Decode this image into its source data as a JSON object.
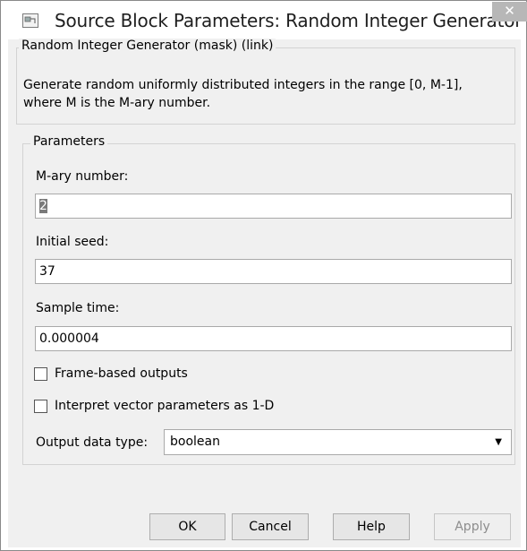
{
  "window": {
    "title": "Source Block Parameters: Random Integer Generator",
    "close_glyph": "✕"
  },
  "block_group": {
    "legend": "Random Integer Generator (mask) (link)",
    "description_line1": "Generate random uniformly distributed integers in the range [0, M-1],",
    "description_line2": "where M is the M-ary number."
  },
  "parameters": {
    "legend": "Parameters",
    "mary_label": "M-ary number:",
    "mary_value": "2",
    "seed_label": "Initial seed:",
    "seed_value": "37",
    "sample_label": "Sample time:",
    "sample_value": "0.000004",
    "frame_based_label": "Frame-based outputs",
    "frame_based_checked": false,
    "interpret_label": "Interpret vector parameters as 1-D",
    "interpret_checked": false,
    "output_type_label": "Output data type:",
    "output_type_value": "boolean",
    "dropdown_glyph": "▼"
  },
  "buttons": {
    "ok": "OK",
    "cancel": "Cancel",
    "help": "Help",
    "apply": "Apply"
  }
}
